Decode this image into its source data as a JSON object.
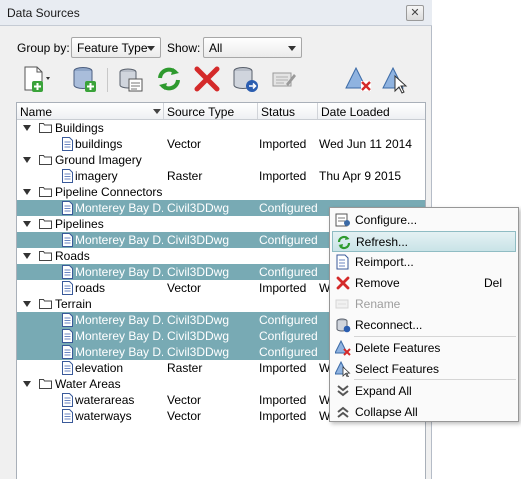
{
  "window": {
    "title": "Data Sources",
    "close_glyph": "✕"
  },
  "filters": {
    "group_by_label": "Group by:",
    "group_by_value": "Feature Type",
    "show_label": "Show:",
    "show_value": "All"
  },
  "toolbar": {
    "icons": [
      "new-data-source-icon",
      "add-database-icon",
      "configure-sources-icon",
      "refresh-icon",
      "remove-icon",
      "reconnect-icon",
      "rename-icon",
      "delete-features-icon",
      "select-features-icon"
    ]
  },
  "columns": [
    "Name",
    "Source Type",
    "Status",
    "Date Loaded"
  ],
  "rows": [
    {
      "kind": "group",
      "name": "Buildings"
    },
    {
      "kind": "item",
      "name": "buildings",
      "type": "Vector",
      "status": "Imported",
      "date": "Wed Jun 11 2014",
      "selected": false
    },
    {
      "kind": "group",
      "name": "Ground Imagery"
    },
    {
      "kind": "item",
      "name": "imagery",
      "type": "Raster",
      "status": "Imported",
      "date": "Thu Apr 9 2015",
      "selected": false
    },
    {
      "kind": "group",
      "name": "Pipeline Connectors"
    },
    {
      "kind": "item",
      "name": "Monterey Bay D...",
      "type": "Civil3DDwg",
      "status": "Configured",
      "date": "",
      "selected": true
    },
    {
      "kind": "group",
      "name": "Pipelines"
    },
    {
      "kind": "item",
      "name": "Monterey Bay D...",
      "type": "Civil3DDwg",
      "status": "Configured",
      "date": "",
      "selected": true
    },
    {
      "kind": "group",
      "name": "Roads"
    },
    {
      "kind": "item",
      "name": "Monterey Bay D...",
      "type": "Civil3DDwg",
      "status": "Configured",
      "date": "",
      "selected": true
    },
    {
      "kind": "item",
      "name": "roads",
      "type": "Vector",
      "status": "Imported",
      "date": "W",
      "selected": false
    },
    {
      "kind": "group",
      "name": "Terrain"
    },
    {
      "kind": "item",
      "name": "Monterey Bay D...",
      "type": "Civil3DDwg",
      "status": "Configured",
      "date": "",
      "selected": true
    },
    {
      "kind": "item",
      "name": "Monterey Bay D...",
      "type": "Civil3DDwg",
      "status": "Configured",
      "date": "",
      "selected": true
    },
    {
      "kind": "item",
      "name": "Monterey Bay D...",
      "type": "Civil3DDwg",
      "status": "Configured",
      "date": "",
      "selected": true
    },
    {
      "kind": "item",
      "name": "elevation",
      "type": "Raster",
      "status": "Imported",
      "date": "W",
      "selected": false
    },
    {
      "kind": "group",
      "name": "Water Areas"
    },
    {
      "kind": "item",
      "name": "waterareas",
      "type": "Vector",
      "status": "Imported",
      "date": "W",
      "selected": false
    },
    {
      "kind": "item",
      "name": "waterways",
      "type": "Vector",
      "status": "Imported",
      "date": "W",
      "selected": false
    }
  ],
  "context_menu": {
    "items": [
      {
        "label": "Configure...",
        "icon": "configure-icon",
        "shortcut": "",
        "disabled": false,
        "hover": false
      },
      {
        "label": "Refresh...",
        "icon": "refresh-icon",
        "shortcut": "",
        "disabled": false,
        "hover": true
      },
      {
        "label": "Reimport...",
        "icon": "reimport-icon",
        "shortcut": "",
        "disabled": false,
        "hover": false
      },
      {
        "label": "Remove",
        "icon": "remove-icon",
        "shortcut": "Del",
        "disabled": false,
        "hover": false
      },
      {
        "label": "Rename",
        "icon": "rename-icon",
        "shortcut": "",
        "disabled": true,
        "hover": false
      },
      {
        "label": "Reconnect...",
        "icon": "reconnect-icon",
        "shortcut": "",
        "disabled": false,
        "hover": false
      },
      {
        "label": "Delete Features",
        "icon": "delete-features-icon",
        "shortcut": "",
        "disabled": false,
        "hover": false
      },
      {
        "label": "Select Features",
        "icon": "select-features-icon",
        "shortcut": "",
        "disabled": false,
        "hover": false
      },
      {
        "label": "Expand All",
        "icon": "expand-all-icon",
        "shortcut": "",
        "disabled": false,
        "hover": false
      },
      {
        "label": "Collapse All",
        "icon": "collapse-all-icon",
        "shortcut": "",
        "disabled": false,
        "hover": false
      }
    ]
  },
  "colors": {
    "selection": "#78aab4",
    "menu_hover": "#c9e3e7"
  }
}
